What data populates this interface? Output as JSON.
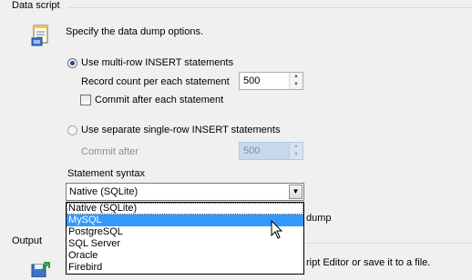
{
  "data_script": {
    "section_label": "Data script",
    "description": "Specify the data dump options.",
    "multi_row": {
      "label": "Use multi-row INSERT statements",
      "selected": true,
      "record_count_label": "Record count per each statement",
      "record_count_value": "500",
      "commit_label": "Commit after each statement",
      "commit_checked": false
    },
    "single_row": {
      "label": "Use separate single-row INSERT statements",
      "selected": false,
      "commit_after_label": "Commit after",
      "commit_after_value": "500"
    },
    "statement_syntax": {
      "label": "Statement syntax",
      "selected": "Native (SQLite)",
      "options": [
        "Native (SQLite)",
        "MySQL",
        "PostgreSQL",
        "SQL Server",
        "Oracle",
        "Firebird"
      ],
      "highlighted": "MySQL"
    },
    "hidden_checkbox_tail": "dump"
  },
  "output": {
    "section_label": "Output",
    "description_tail": "ript Editor or save it to a file."
  },
  "colors": {
    "selection": "#3399ff",
    "separator": "#d5dfe5",
    "disabled_field": "#c7d9ec"
  }
}
